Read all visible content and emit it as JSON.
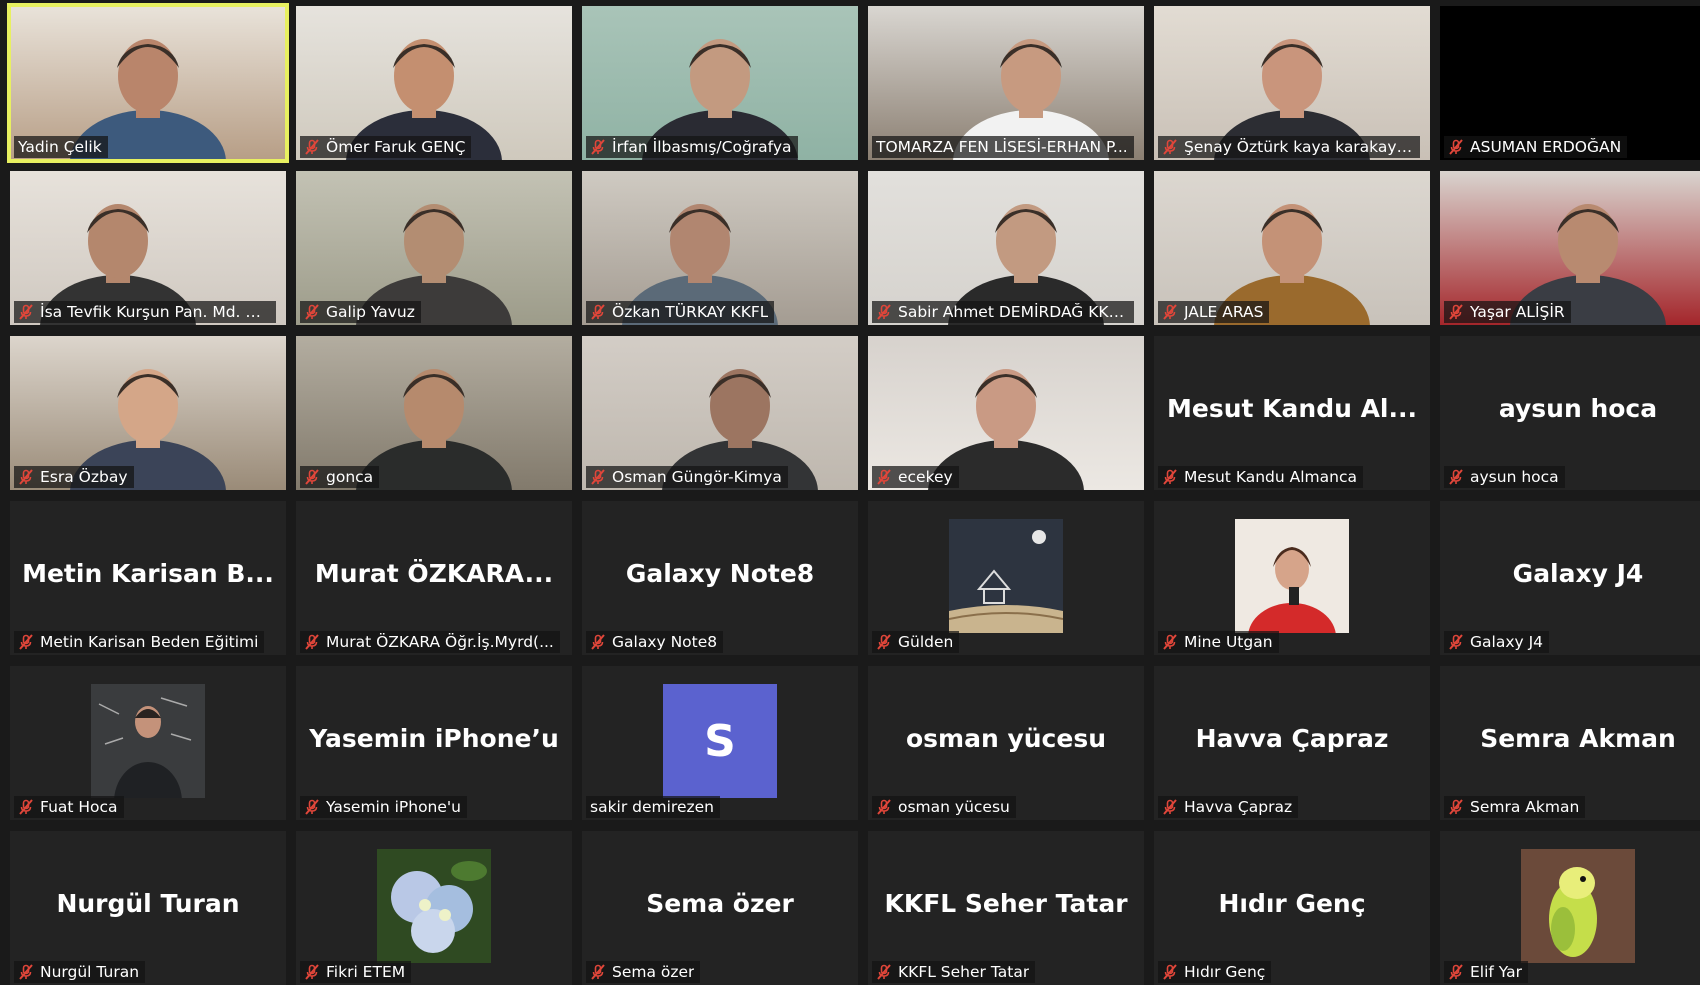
{
  "participants": [
    {
      "name": "Yadin Çelik",
      "muted": false,
      "type": "video",
      "scene": "sceneA",
      "active": true
    },
    {
      "name": "Ömer Faruk GENÇ",
      "muted": true,
      "type": "video",
      "scene": "sceneB"
    },
    {
      "name": "İrfan İlbasmış/Coğrafya",
      "muted": true,
      "type": "video",
      "scene": "sceneC"
    },
    {
      "name": "TOMARZA FEN LİSESİ-ERHAN P...",
      "muted": false,
      "type": "video",
      "scene": "sceneD"
    },
    {
      "name": "Şenay Öztürk kaya karakaya ...",
      "muted": true,
      "type": "video",
      "scene": "sceneE"
    },
    {
      "name": "ASUMAN ERDOĞAN",
      "muted": true,
      "type": "black"
    },
    {
      "name": "İsa Tevfik Kurşun Pan. Md. Yrd.",
      "muted": true,
      "type": "video",
      "scene": "sceneF"
    },
    {
      "name": "Galip Yavuz",
      "muted": true,
      "type": "video",
      "scene": "sceneG"
    },
    {
      "name": "Özkan TÜRKAY KKFL",
      "muted": true,
      "type": "video",
      "scene": "sceneH"
    },
    {
      "name": "Sabir Ahmet DEMİRDAĞ KKF...",
      "muted": true,
      "type": "video",
      "scene": "sceneI"
    },
    {
      "name": "JALE ARAS",
      "muted": true,
      "type": "video",
      "scene": "sceneJ"
    },
    {
      "name": "Yaşar ALİŞİR",
      "muted": true,
      "type": "video",
      "scene": "sceneK"
    },
    {
      "name": "Esra Özbay",
      "muted": true,
      "type": "video",
      "scene": "sceneL"
    },
    {
      "name": "gonca",
      "muted": true,
      "type": "video",
      "scene": "sceneM"
    },
    {
      "name": "Osman Güngör-Kimya",
      "muted": true,
      "type": "video",
      "scene": "sceneN"
    },
    {
      "name": "ecekey",
      "muted": true,
      "type": "video",
      "scene": "sceneO"
    },
    {
      "name": "Mesut Kandu Almanca",
      "muted": true,
      "type": "text",
      "display": "Mesut  Kandu  Al..."
    },
    {
      "name": "aysun hoca",
      "muted": true,
      "type": "text",
      "display": "aysun hoca"
    },
    {
      "name": "Metin Karisan Beden Eğitimi",
      "muted": true,
      "type": "text",
      "display": "Metin  Karisan  B..."
    },
    {
      "name": "Murat ÖZKARA Öğr.İş.Myrd(...",
      "muted": true,
      "type": "text",
      "display": "Murat  ÖZKARA..."
    },
    {
      "name": "Galaxy Note8",
      "muted": true,
      "type": "text",
      "display": "Galaxy Note8"
    },
    {
      "name": "Gülden",
      "muted": true,
      "type": "thumb",
      "thumb": "book"
    },
    {
      "name": "Mine Utgan",
      "muted": true,
      "type": "thumb",
      "thumb": "woman-red"
    },
    {
      "name": "Galaxy J4",
      "muted": true,
      "type": "text",
      "display": "Galaxy J4"
    },
    {
      "name": "Fuat Hoca",
      "muted": true,
      "type": "thumb",
      "thumb": "man-board"
    },
    {
      "name": "Yasemin iPhone'u",
      "muted": true,
      "type": "text",
      "display": "Yasemin iPhone’u"
    },
    {
      "name": "sakir demirezen",
      "muted": false,
      "type": "avatar",
      "letter": "S"
    },
    {
      "name": "osman yücesu",
      "muted": true,
      "type": "text",
      "display": "osman yücesu"
    },
    {
      "name": "Havva Çapraz",
      "muted": true,
      "type": "text",
      "display": "Havva Çapraz"
    },
    {
      "name": "Semra Akman",
      "muted": true,
      "type": "text",
      "display": "Semra Akman"
    },
    {
      "name": "Nurgül Turan",
      "muted": true,
      "type": "text",
      "display": "Nurgül Turan"
    },
    {
      "name": "Fikri ETEM",
      "muted": true,
      "type": "thumb",
      "thumb": "flowers"
    },
    {
      "name": "Sema özer",
      "muted": true,
      "type": "text",
      "display": "Sema özer"
    },
    {
      "name": "KKFL Seher Tatar",
      "muted": true,
      "type": "text",
      "display": "KKFL Seher Tatar"
    },
    {
      "name": "Hıdır Genç",
      "muted": true,
      "type": "text",
      "display": "Hıdır Genç"
    },
    {
      "name": "Elif Yar",
      "muted": true,
      "type": "thumb",
      "thumb": "parrot"
    }
  ],
  "colors": {
    "active_border": "#e8f060",
    "mute": "#e0463a",
    "avatar": "#5b62cf"
  }
}
